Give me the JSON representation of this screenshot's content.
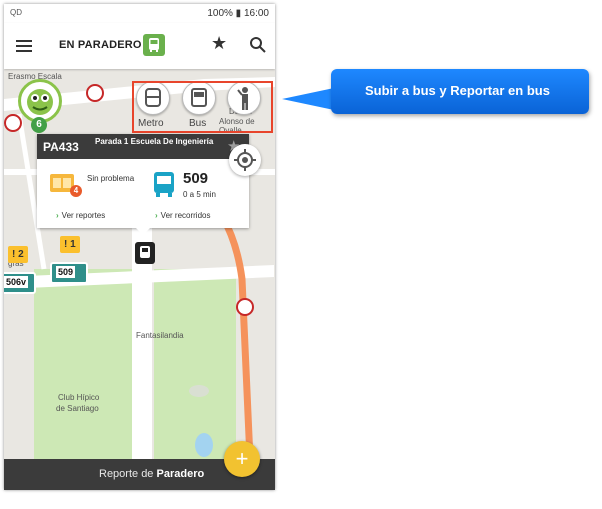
{
  "status_bar": {
    "left": "QD",
    "right": "100% ▮ 16:00"
  },
  "app_bar": {
    "title": "EN PARADERO",
    "menu_icon": "menu-icon",
    "bus_badge_icon": "bus-icon",
    "favorite_icon": "star-icon",
    "search_icon": "search-icon"
  },
  "map": {
    "street_labels": [
      "Erasmo Escala",
      "Dueño",
      "Alonso de Ovalle",
      "Fantasilandia",
      "Club Hípico",
      "de Santiago",
      "gras"
    ],
    "nearby_buttons": [
      {
        "label": "Metro",
        "icon": "metro-icon"
      },
      {
        "label": "Bus",
        "icon": "bus-icon"
      },
      {
        "label": "",
        "icon": "person-waiting-icon"
      }
    ],
    "user_level": "6",
    "alerts": [
      "! 2",
      "! 1"
    ],
    "buses": [
      "506v",
      "509"
    ]
  },
  "stop_card": {
    "code": "PA433",
    "name": "Parada 1 Escuela De Ingeniería",
    "report_count": "4",
    "status": "Sin problema",
    "route": "509",
    "eta": "0 a 5 min",
    "link_reports": "Ver reportes",
    "link_trips": "Ver recorridos"
  },
  "bottom_bar": {
    "prefix": "Reporte de",
    "emphasis": "Paradero",
    "fab_label": "+"
  },
  "annotation": {
    "text": "Subir a bus y Reportar en bus"
  },
  "colors": {
    "accent_green": "#6ab04c",
    "annotation_blue": "#1e88ff",
    "highlight_red": "#e8452c",
    "route_orange": "#f5925b",
    "alert_yellow": "#fbc02d"
  }
}
